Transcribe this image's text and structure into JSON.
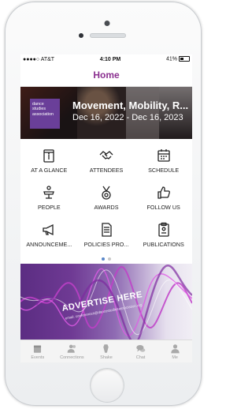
{
  "status_bar": {
    "carrier": "●●●●○ AT&T",
    "time": "4:10 PM",
    "battery": "41%"
  },
  "nav": {
    "title": "Home"
  },
  "banner": {
    "logo_text": "dance studies association",
    "title": "Movement, Mobility, R...",
    "dates": "Dec 16, 2022 - Dec 16, 2023"
  },
  "grid": {
    "items": [
      {
        "label": "AT A GLANCE",
        "icon": "info-icon"
      },
      {
        "label": "ATTENDEES",
        "icon": "handshake-icon"
      },
      {
        "label": "SCHEDULE",
        "icon": "calendar-icon"
      },
      {
        "label": "PEOPLE",
        "icon": "podium-icon"
      },
      {
        "label": "AWARDS",
        "icon": "medal-icon"
      },
      {
        "label": "FOLLOW US",
        "icon": "thumbs-up-icon"
      },
      {
        "label": "ANNOUNCEME...",
        "icon": "megaphone-icon"
      },
      {
        "label": "POLICIES PRO...",
        "icon": "document-icon"
      },
      {
        "label": "PUBLICATIONS",
        "icon": "clipboard-icon"
      }
    ],
    "page_indicator": {
      "current": 1,
      "total": 2
    }
  },
  "ad": {
    "headline": "ADVERTISE HERE",
    "subtext": "email: conferences@dancestudiesassociation.org"
  },
  "tabbar": {
    "items": [
      {
        "label": "Events",
        "icon": "calendar-icon"
      },
      {
        "label": "Connections",
        "icon": "people-icon"
      },
      {
        "label": "Shake",
        "icon": "shake-icon"
      },
      {
        "label": "Chat",
        "icon": "chat-bubbles-icon"
      },
      {
        "label": "Me",
        "icon": "person-icon"
      }
    ]
  },
  "colors": {
    "accent": "#8a2f8f",
    "page_dot_active": "#5a87c9",
    "tab_inactive": "#9a9a9a"
  }
}
